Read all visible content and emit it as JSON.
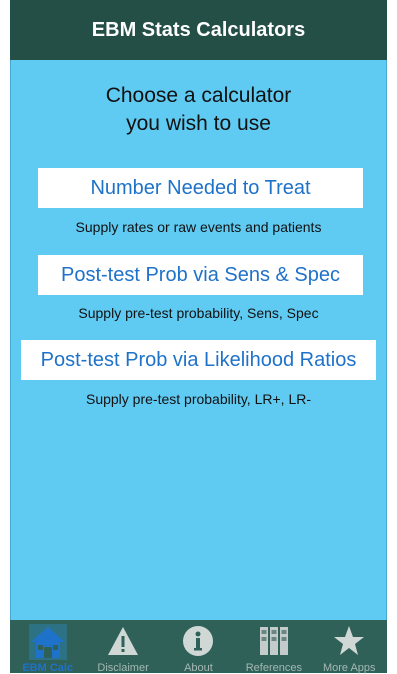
{
  "navbar": {
    "title": "EBM Stats Calculators"
  },
  "prompt": {
    "line1": "Choose a calculator",
    "line2": "you wish to use"
  },
  "calculators": [
    {
      "label": "Number Needed to Treat",
      "description": "Supply rates or raw events and patients"
    },
    {
      "label": "Post-test Prob via Sens & Spec",
      "description": "Supply pre-test probability, Sens, Spec"
    },
    {
      "label": "Post-test Prob via Likelihood Ratios",
      "description": "Supply pre-test probability, LR+, LR-"
    }
  ],
  "tabs": [
    {
      "label": "EBM Calc",
      "icon": "home-icon",
      "active": true
    },
    {
      "label": "Disclaimer",
      "icon": "warning-icon",
      "active": false
    },
    {
      "label": "About",
      "icon": "info-icon",
      "active": false
    },
    {
      "label": "References",
      "icon": "books-icon",
      "active": false
    },
    {
      "label": "More Apps",
      "icon": "star-icon",
      "active": false
    }
  ],
  "colors": {
    "navbar": "#244f47",
    "content_bg": "#5fcaf2",
    "button_text": "#1e72c9",
    "tabbar": "#2f6159",
    "tab_active": "#1e72c9"
  }
}
